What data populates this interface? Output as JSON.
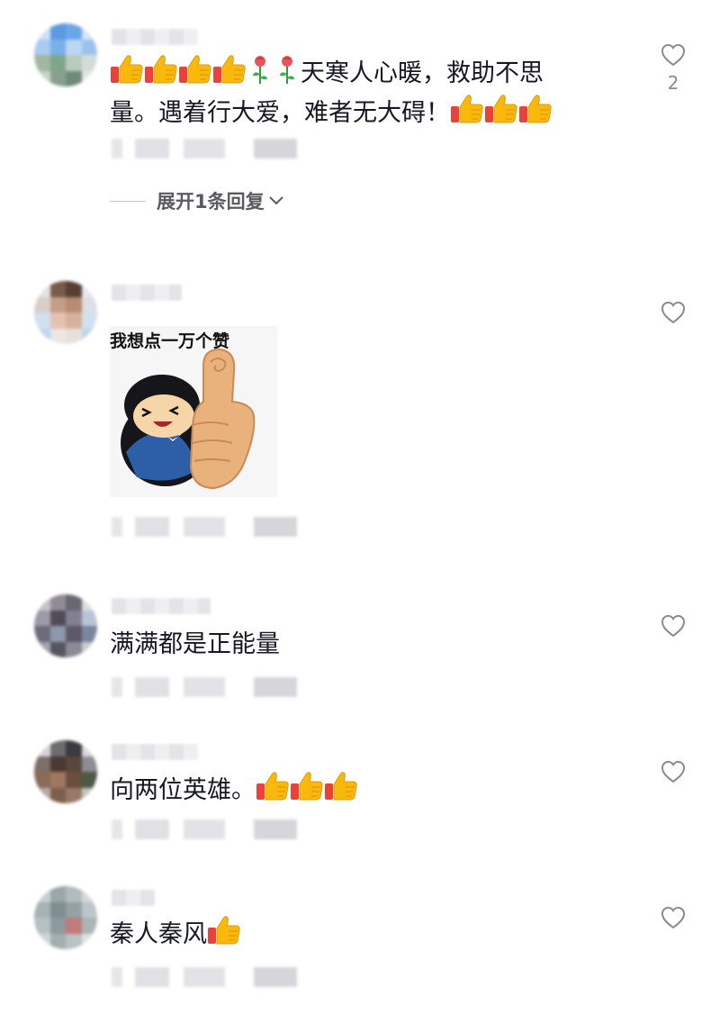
{
  "comments": [
    {
      "text_prefix_emojis": [
        "thumbs-up",
        "thumbs-up",
        "thumbs-up",
        "thumbs-up",
        "rose",
        "rose"
      ],
      "text_line1": "天寒人心暖，救助不思",
      "text_line2": "量。遇着行大爱，难者无大碍！",
      "text_suffix_emojis": [
        "thumbs-up",
        "thumbs-up",
        "thumbs-up"
      ],
      "like_count": "2",
      "expand_label": "展开1条回复"
    },
    {
      "sticker_caption": "我想点一万个赞",
      "sticker_icon": "thumbs-up-man-sticker"
    },
    {
      "text": "满满都是正能量"
    },
    {
      "text": "向两位英雄。",
      "suffix_emojis": [
        "thumbs-up",
        "thumbs-up",
        "thumbs-up"
      ]
    },
    {
      "text": "秦人秦风",
      "suffix_emojis": [
        "thumbs-up"
      ]
    }
  ],
  "colors": {
    "text": "#161823",
    "secondary": "#8a8b91",
    "thumb_yellow": "#f7b500",
    "thumb_red": "#e83e3a"
  }
}
